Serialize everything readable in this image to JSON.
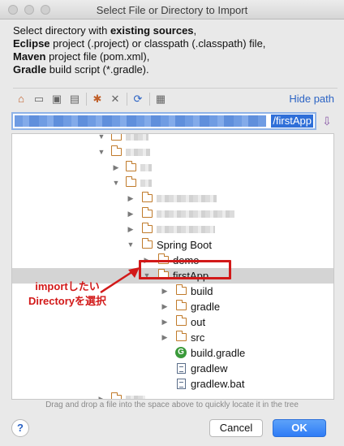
{
  "window": {
    "title": "Select File or Directory to Import"
  },
  "description": {
    "line1_pre": "Select directory with ",
    "line1_bold": "existing sources",
    "line1_post": ",",
    "line2_bold": "Eclipse",
    "line2_post": " project (.project) or classpath (.classpath) file,",
    "line3_bold": "Maven",
    "line3_post": " project file (pom.xml),",
    "line4_bold": "Gradle",
    "line4_post": " build script (*.gradle)."
  },
  "toolbar": {
    "icons": [
      "home-icon",
      "desktop-icon",
      "project-icon",
      "module-icon",
      "new-folder-icon",
      "delete-icon",
      "refresh-icon",
      "show-hidden-icon"
    ],
    "hide_path_label": "Hide path"
  },
  "path": {
    "visible_tail": "/firstApp"
  },
  "tree": {
    "items": [
      {
        "label": "Spring Boot"
      },
      {
        "label": "demo"
      },
      {
        "label": "firstApp"
      },
      {
        "label": "build"
      },
      {
        "label": "gradle"
      },
      {
        "label": "out"
      },
      {
        "label": "src"
      },
      {
        "label": "build.gradle"
      },
      {
        "label": "gradlew"
      },
      {
        "label": "gradlew.bat"
      }
    ]
  },
  "annotation": {
    "line1": "importしたい",
    "line2": "Directoryを選択"
  },
  "hint": "Drag and drop a file into the space above to quickly locate it in the tree",
  "buttons": {
    "help": "?",
    "cancel": "Cancel",
    "ok": "OK"
  },
  "colors": {
    "accent": "#2f7cf6",
    "annotation": "#d21919",
    "folder": "#c07a2a"
  }
}
